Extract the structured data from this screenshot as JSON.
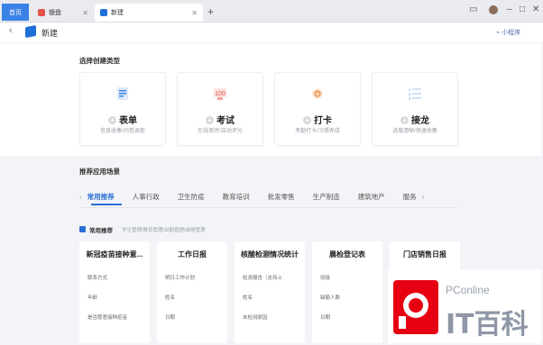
{
  "tabs": [
    {
      "label": "首页",
      "active": false
    },
    {
      "label": "银盘",
      "active": false
    },
    {
      "label": "新建",
      "active": true
    }
  ],
  "header": {
    "title": "新建",
    "mini_program": "小程序"
  },
  "create_section": {
    "title": "选择创建类型",
    "cards": [
      {
        "name": "表单",
        "desc": "信息收集/问卷调查",
        "icon": "form-icon"
      },
      {
        "name": "考试",
        "desc": "在线测评/自动评分",
        "icon": "exam-icon"
      },
      {
        "name": "打卡",
        "desc": "考勤打卡/习惯养成",
        "icon": "checkin-icon"
      },
      {
        "name": "接龙",
        "desc": "进度清晰/快速收集",
        "icon": "chain-icon"
      }
    ]
  },
  "scene_section": {
    "title": "推荐应用场景",
    "categories": [
      "常用推荐",
      "人事行政",
      "卫生防疫",
      "教育培训",
      "批发零售",
      "生产制造",
      "建筑地产",
      "服务"
    ],
    "active_category": "常用推荐",
    "filter_label": "常用推荐",
    "filter_desc": "学生管理/教育管理/出勤管理/成绩管理",
    "templates": [
      {
        "title": "新冠疫苗接种意...",
        "fields": [
          "联系方式",
          "年龄",
          "是否愿意接种疫苗"
        ]
      },
      {
        "title": "工作日报",
        "fields": [
          "明日工作计划",
          "姓名",
          "日期"
        ]
      },
      {
        "title": "核酸检测情况统计",
        "fields": [
          "检测报告（支持上",
          "姓名",
          "未检测原因"
        ]
      },
      {
        "title": "晨检登记表",
        "fields": [
          "班级",
          "缺勤人数",
          "日期"
        ]
      },
      {
        "title": "门店销售日报",
        "fields": []
      }
    ]
  },
  "watermark": {
    "brand": "PConline",
    "name": "IT百科"
  },
  "colors": {
    "accent": "#2b6fd6",
    "home_tab": "#3b82e6"
  }
}
